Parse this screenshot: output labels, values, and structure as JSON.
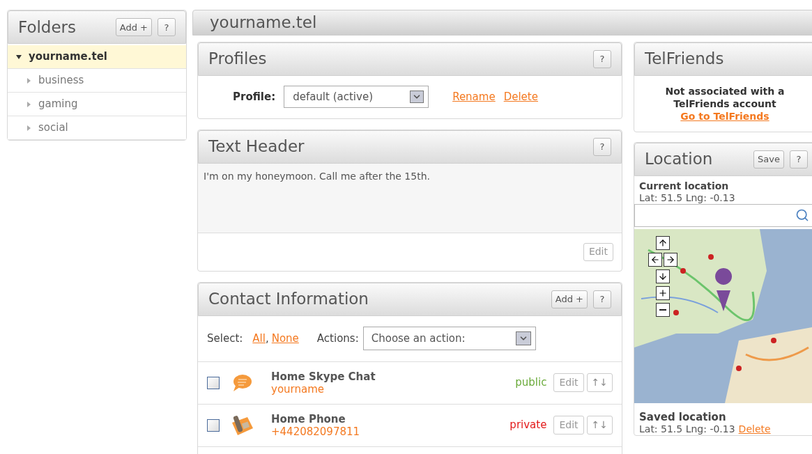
{
  "folders": {
    "title": "Folders",
    "add_button": "Add +",
    "help_button": "?",
    "items": [
      {
        "label": "yourname.tel",
        "selected": true,
        "expanded": true,
        "children": [
          {
            "label": "business",
            "selected": false,
            "expanded": false
          },
          {
            "label": "gaming",
            "selected": false,
            "expanded": false
          },
          {
            "label": "social",
            "selected": false,
            "expanded": false
          }
        ]
      }
    ]
  },
  "page_title": "yourname.tel",
  "profiles": {
    "title": "Profiles",
    "help_button": "?",
    "label": "Profile:",
    "value": "default (active)",
    "links": [
      "Rename",
      "Delete"
    ]
  },
  "text_header": {
    "title": "Text Header",
    "help_button": "?",
    "text": "I'm on my honeymoon. Call me after the 15th.",
    "edit_button": "Edit"
  },
  "contact_information": {
    "title": "Contact Information",
    "add_button": "Add +",
    "help_button": "?",
    "select_label": "Select:",
    "select_links": [
      "All",
      "None"
    ],
    "select_separator": ",",
    "actions_label": "Actions:",
    "actions_placeholder": "Choose an action:",
    "rows": [
      {
        "kind": "chat",
        "name": "Home Skype Chat",
        "value": "yourname",
        "visibility": "public",
        "checked": false,
        "edit_button": "Edit",
        "move_button": "↑↓"
      },
      {
        "kind": "phone",
        "name": "Home Phone",
        "value": "+442082097811",
        "visibility": "private",
        "checked": false,
        "edit_button": "Edit",
        "move_button": "↑↓"
      }
    ]
  },
  "telfriends": {
    "title": "TelFriends",
    "message": "Not associated with a TelFriends account",
    "link": "Go to TelFriends"
  },
  "location": {
    "title": "Location",
    "save_button": "Save",
    "help_button": "?",
    "current_title": "Current location",
    "current_coords": "Lat: 51.5 Lng: -0.13",
    "saved_title": "Saved location",
    "saved_coords": "Lat: 51.5 Lng: -0.13",
    "delete_link": "Delete"
  }
}
